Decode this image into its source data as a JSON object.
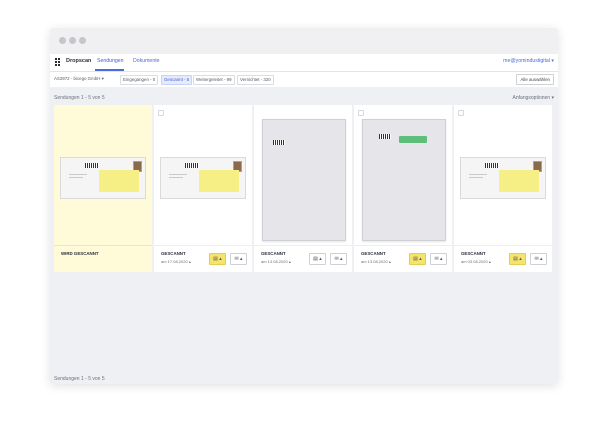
{
  "nav": {
    "brand": "Dropscan",
    "tabs": [
      "Sendungen",
      "Dokumente"
    ],
    "user": "me@yomindustigital"
  },
  "filters": {
    "account": "AS2972 - bicego GmbH",
    "chips": [
      "Eingegangen - 0",
      "Gescannt - 5",
      "Weitergeleitet - 99",
      "Vernichtet - 320"
    ],
    "active_chip": "Gescannt - 5",
    "select_all": "Alle auswählen"
  },
  "list": {
    "count_label": "Sendungen 1 - 5 von 5",
    "sort_label": "Anfangsoptionen",
    "footer_label": "Sendungen 1 - 5 von 5"
  },
  "cards": [
    {
      "status": "WIRD GESCANNT",
      "date": "",
      "selected": true,
      "kind": "envelope"
    },
    {
      "status": "GESCANNT",
      "date": "am 17.08.2020",
      "selected": false,
      "kind": "envelope"
    },
    {
      "status": "GESCANNT",
      "date": "am 13.08.2020",
      "selected": false,
      "kind": "page"
    },
    {
      "status": "GESCANNT",
      "date": "am 13.08.2020",
      "selected": false,
      "kind": "page-tag"
    },
    {
      "status": "GESCANNT",
      "date": "am 03.08.2020",
      "selected": false,
      "kind": "envelope"
    }
  ],
  "icons": {
    "scan": "document-scan-icon",
    "mail": "envelope-icon",
    "caret": "caret-up-icon"
  },
  "colors": {
    "accent": "#4b6cd8",
    "highlight": "#f5e46a",
    "selected_card": "#fffbd8",
    "tag_green": "#5fbf7a"
  }
}
